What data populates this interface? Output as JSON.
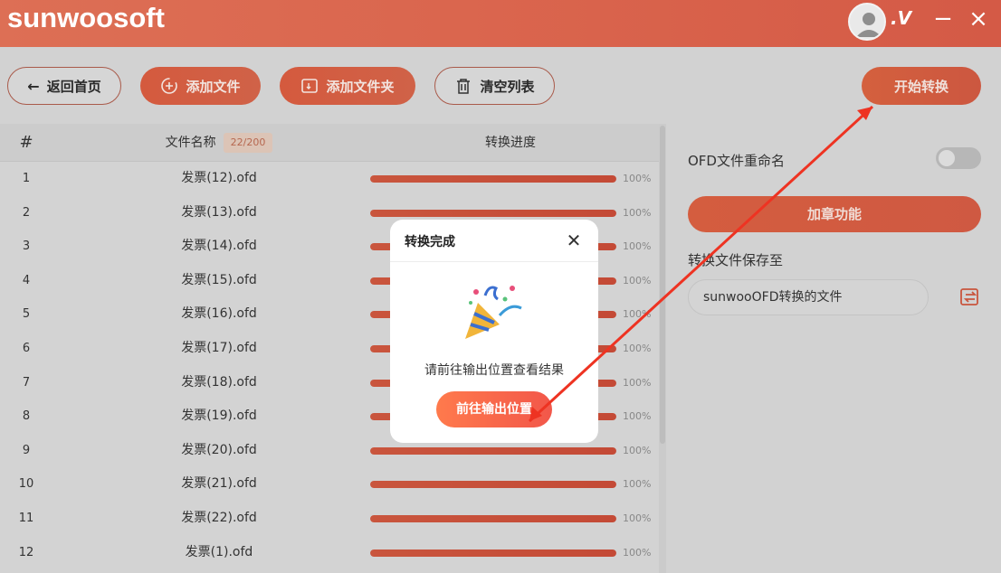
{
  "app": {
    "logo": "sunwoosoft",
    "vip_mark": ".V",
    "minimize": "−",
    "close": "×"
  },
  "toolbar": {
    "back_label": "返回首页",
    "add_file_label": "添加文件",
    "add_folder_label": "添加文件夹",
    "clear_label": "清空列表",
    "start_label": "开始转换"
  },
  "table": {
    "col_index": "#",
    "col_name": "文件名称",
    "count": "22/200",
    "col_progress": "转换进度",
    "rows": [
      {
        "index": "1",
        "name": "发票(12).ofd",
        "progress": 1.0,
        "pct": "100%"
      },
      {
        "index": "2",
        "name": "发票(13).ofd",
        "progress": 1.0,
        "pct": "100%"
      },
      {
        "index": "3",
        "name": "发票(14).ofd",
        "progress": 1.0,
        "pct": "100%"
      },
      {
        "index": "4",
        "name": "发票(15).ofd",
        "progress": 1.0,
        "pct": "100%"
      },
      {
        "index": "5",
        "name": "发票(16).ofd",
        "progress": 1.0,
        "pct": "100%"
      },
      {
        "index": "6",
        "name": "发票(17).ofd",
        "progress": 1.0,
        "pct": "100%"
      },
      {
        "index": "7",
        "name": "发票(18).ofd",
        "progress": 1.0,
        "pct": "100%"
      },
      {
        "index": "8",
        "name": "发票(19).ofd",
        "progress": 1.0,
        "pct": "100%"
      },
      {
        "index": "9",
        "name": "发票(20).ofd",
        "progress": 1.0,
        "pct": "100%"
      },
      {
        "index": "10",
        "name": "发票(21).ofd",
        "progress": 1.0,
        "pct": "100%"
      },
      {
        "index": "11",
        "name": "发票(22).ofd",
        "progress": 1.0,
        "pct": "100%"
      },
      {
        "index": "12",
        "name": "发票(1).ofd",
        "progress": 1.0,
        "pct": "100%"
      }
    ]
  },
  "right_panel": {
    "rename_label": "OFD文件重命名",
    "rename_enabled": false,
    "seal_label": "加章功能",
    "save_to_label": "转换文件保存至",
    "save_path": "sunwooOFD转换的文件"
  },
  "modal": {
    "title": "转换完成",
    "message": "请前往输出位置查看结果",
    "go_label": "前往输出位置"
  },
  "colors": {
    "brand": "#dd6f55",
    "arrow": "#ee3322"
  }
}
